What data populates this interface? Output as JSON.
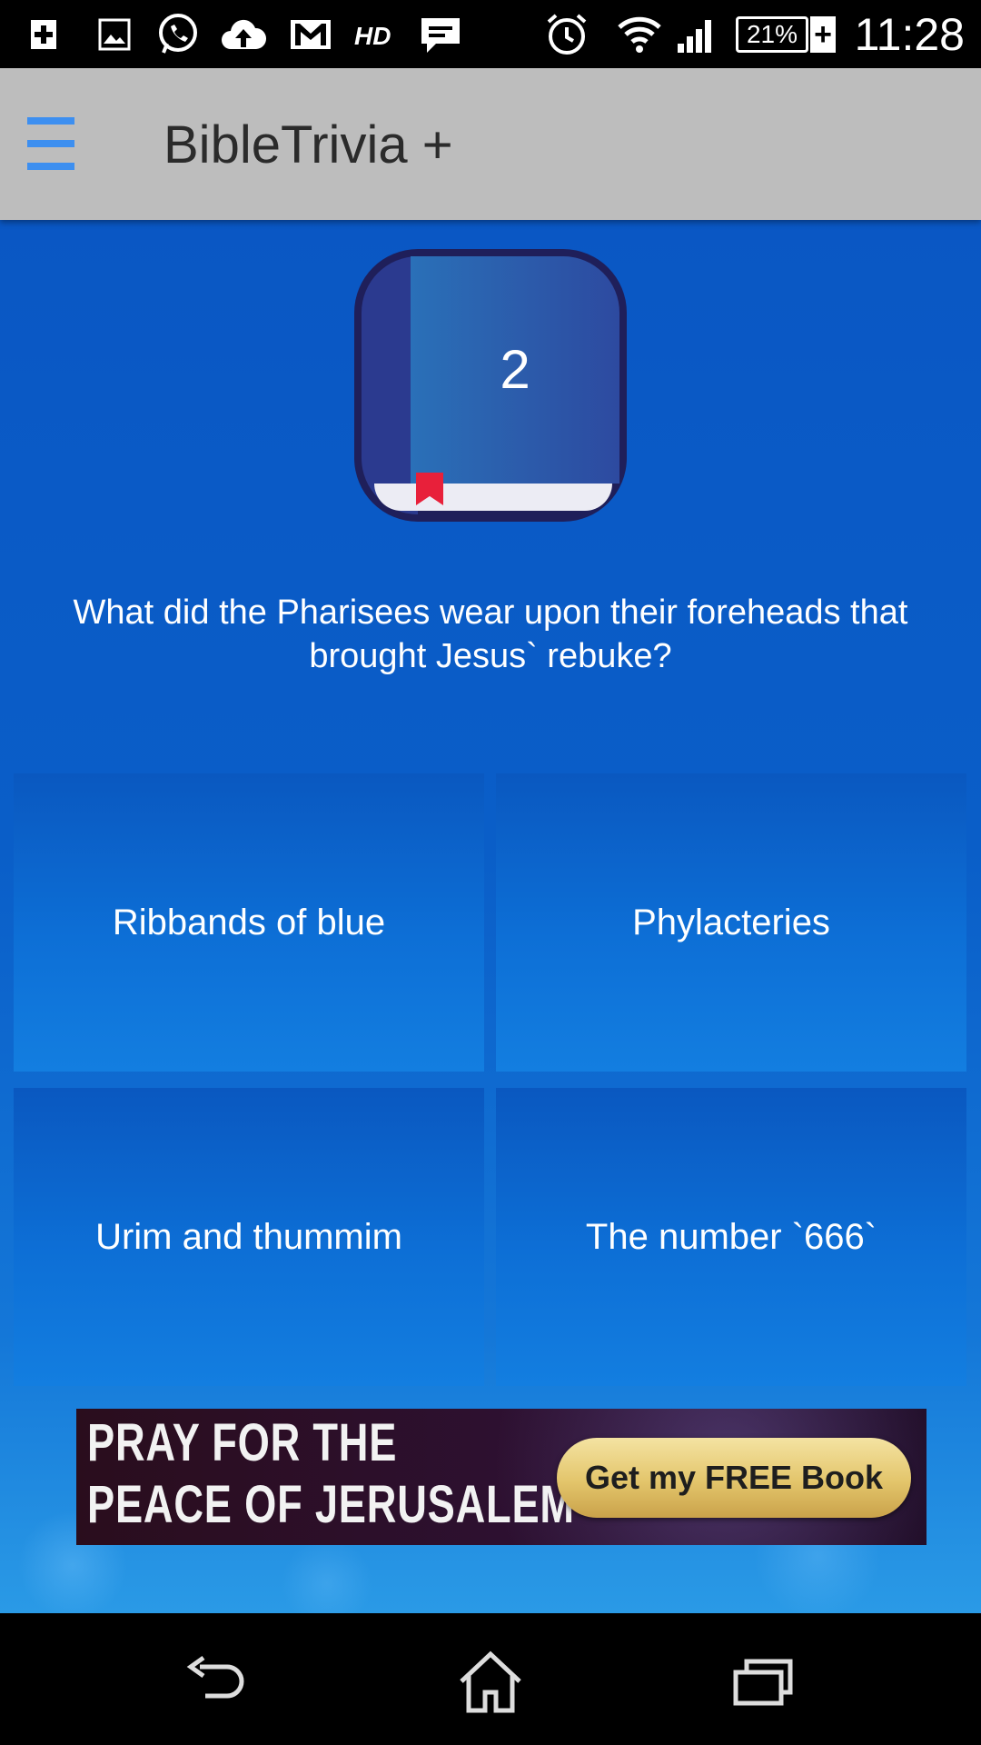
{
  "status_bar": {
    "time": "11:28",
    "battery_percent": "21%",
    "battery_charging_symbol": "+",
    "icons": [
      "medical-plus-icon",
      "gallery-icon",
      "whatsapp-icon",
      "cloud-upload-icon",
      "gmail-icon",
      "hd-icon",
      "chat-icon",
      "alarm-icon",
      "wifi-icon",
      "signal-icon",
      "battery-icon"
    ]
  },
  "app_bar": {
    "title": "BibleTrivia +",
    "menu_icon": "hamburger-menu-icon"
  },
  "quiz": {
    "question_number": "2",
    "question": "What did the Pharisees wear upon their foreheads that brought Jesus` rebuke?",
    "answers": [
      {
        "label": "Ribbands of blue"
      },
      {
        "label": "Phylacteries"
      },
      {
        "label": "Urim and thummim"
      },
      {
        "label": "The number `666`"
      }
    ]
  },
  "ad": {
    "line1": "PRAY FOR THE",
    "line2": "PEACE OF JERUSALEM",
    "cta": "Get my FREE Book"
  },
  "nav_bar": {
    "icons": [
      "back-icon",
      "home-icon",
      "recent-apps-icon"
    ]
  },
  "colors": {
    "background_blue": "#0a5ec8",
    "menu_icon": "#3d8ff0",
    "app_bar": "#bdbdbd"
  }
}
